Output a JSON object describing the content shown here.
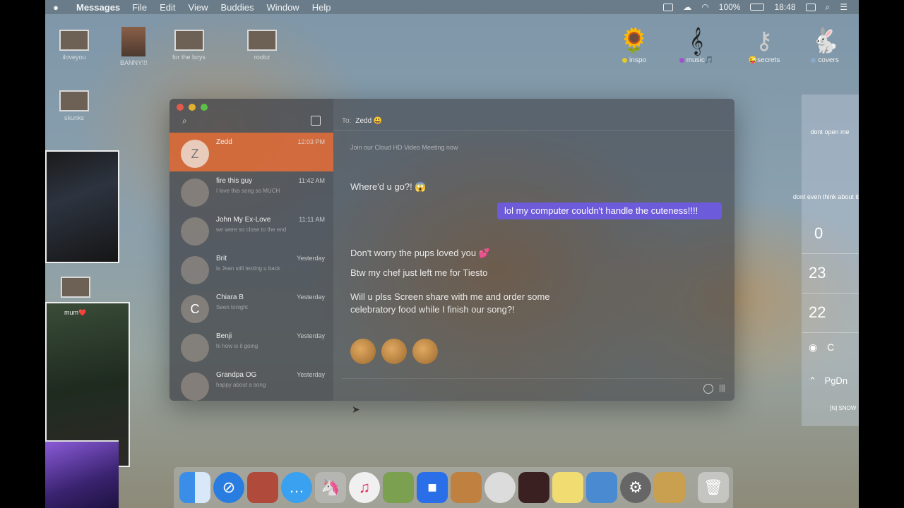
{
  "menubar": {
    "app_name": "Messages",
    "items": [
      "File",
      "Edit",
      "View",
      "Buddies",
      "Window",
      "Help"
    ],
    "battery": "100%",
    "clock": "18:48"
  },
  "desktop_icons_left": [
    {
      "label": "iloveyou"
    },
    {
      "label": "BANNY!!!"
    },
    {
      "label": "for the boys"
    },
    {
      "label": "roobz"
    },
    {
      "label": "skunks"
    },
    {
      "label": ""
    }
  ],
  "desktop_icons_right": [
    {
      "label": "inspo",
      "dot": "#e6c830",
      "glyph": "🌻"
    },
    {
      "label": "music🎵",
      "dot": "#a050d0",
      "glyph": "𝄞"
    },
    {
      "label": "😜secrets",
      "dot": "",
      "glyph": "⚷"
    },
    {
      "label": "covers",
      "dot": "#8aa8c8",
      "glyph": "🐇"
    }
  ],
  "cam2": {
    "label": "mum❤️"
  },
  "messages": {
    "conversations": [
      {
        "initial": "Z",
        "name": "Zedd",
        "time": "12:03 PM",
        "preview": "",
        "active": true
      },
      {
        "initial": "",
        "name": "fire this guy",
        "time": "11:42 AM",
        "preview": "I love this song so MUCH",
        "active": false
      },
      {
        "initial": "",
        "name": "John My Ex-Love",
        "time": "11:11 AM",
        "preview": "we were so close to the end",
        "active": false
      },
      {
        "initial": "",
        "name": "Brit",
        "time": "Yesterday",
        "preview": "is Jean still texting u back",
        "active": false
      },
      {
        "initial": "C",
        "name": "Chiara B",
        "time": "Yesterday",
        "preview": "Seen tonight",
        "active": false
      },
      {
        "initial": "",
        "name": "Benji",
        "time": "Yesterday",
        "preview": "hi how is it going",
        "active": false
      },
      {
        "initial": "",
        "name": "Grandpa OG",
        "time": "Yesterday",
        "preview": "happy about a song",
        "active": false
      }
    ],
    "to_label": "To:",
    "to_name": "Zedd 😃",
    "system_msg": "Join our Cloud HD Video Meeting now",
    "msg1": "Where'd u go?! 😱",
    "msg2": "lol my computer couldn't handle the cuteness!!!!",
    "msg3": "Don't worry the pups loved you 💕",
    "msg4": "Btw my chef just left me for Tiesto",
    "msg5": "Will u plss Screen share with me and order some celebratory food while I finish our song?!"
  },
  "widgets": {
    "label1": "dont open me",
    "label2": "dont even think about it🔐",
    "num1": "0",
    "num2": "23",
    "num3": "22",
    "key1": "C",
    "key2": "PgDn",
    "key3": "[N] SNOW"
  },
  "dock": {
    "items": [
      "finder-icon",
      "safari-icon",
      "photos-icon",
      "messages-icon",
      "launchpad-icon",
      "music-icon",
      "maps-icon",
      "zoom-icon",
      "garageband-icon",
      "logic-icon",
      "photobooth-icon",
      "stickies-icon",
      "preview-icon",
      "system-preferences-icon",
      "folder-icon",
      "trash-icon"
    ]
  },
  "colors": {
    "accent_active": "#e86e37",
    "bubble_out": "#6e5af0"
  }
}
